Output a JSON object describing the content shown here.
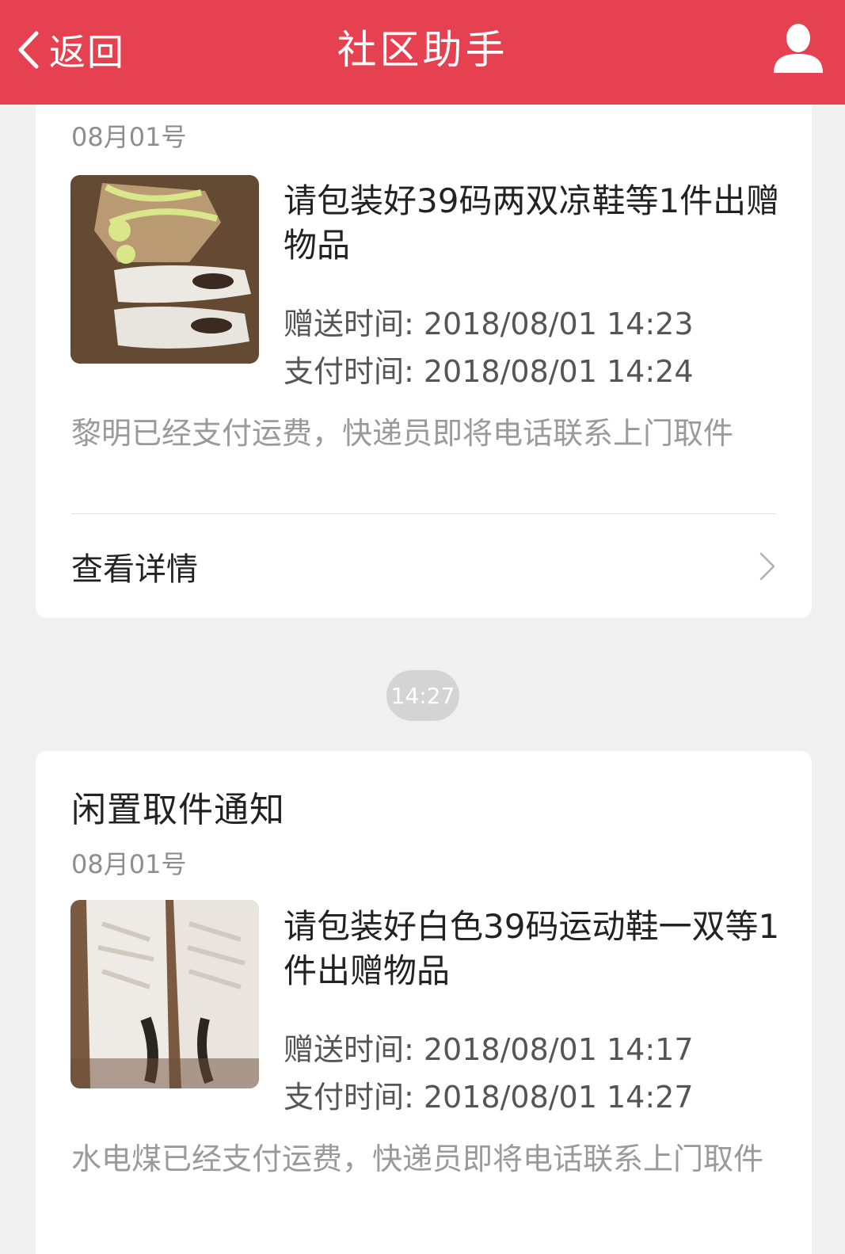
{
  "header": {
    "back_label": "返回",
    "title": "社区助手",
    "back_icon": "chevron-left-icon",
    "user_icon": "user-icon",
    "color": "#e64150"
  },
  "messages": [
    {
      "title": "",
      "date": "08月01号",
      "item_title": "请包装好39码两双凉鞋等1件出赠物品",
      "send_time": "赠送时间: 2018/08/01 14:23",
      "pay_time": "支付时间: 2018/08/01 14:24",
      "description": "黎明已经支付运费，快递员即将电话联系上门取件",
      "details_label": "查看详情"
    },
    {
      "title": "闲置取件通知",
      "date": "08月01号",
      "item_title": "请包装好白色39码运动鞋一双等1件出赠物品",
      "send_time": "赠送时间: 2018/08/01 14:17",
      "pay_time": "支付时间: 2018/08/01 14:27",
      "description": "水电煤已经支付运费，快递员即将电话联系上门取件"
    }
  ],
  "time_divider": "14:27"
}
